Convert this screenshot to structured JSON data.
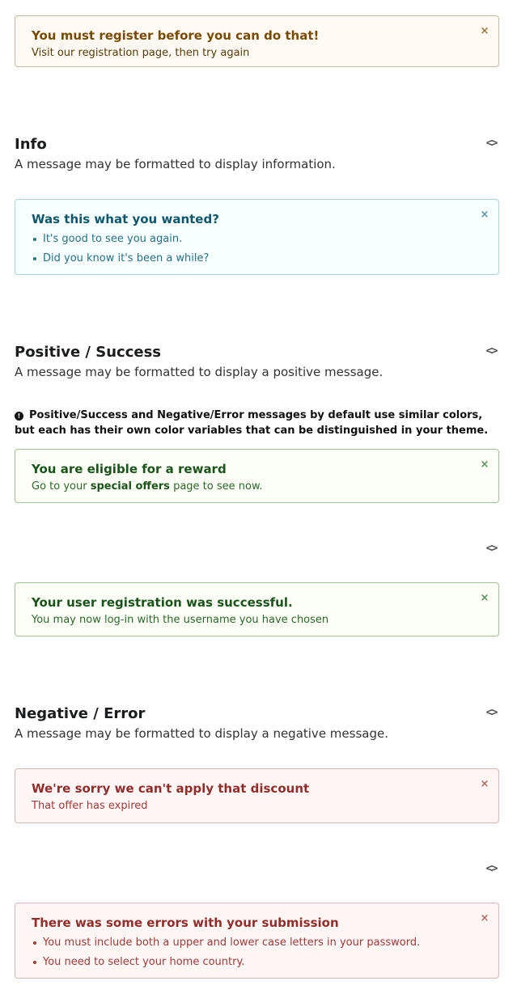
{
  "warning": {
    "header": "You must register before you can do that!",
    "body": "Visit our registration page, then try again",
    "close_icon": "×"
  },
  "sections": {
    "info": {
      "title": "Info",
      "description": "A message may be formatted to display information."
    },
    "positive": {
      "title": "Positive / Success",
      "description": "A message may be formatted to display a positive message."
    },
    "negative": {
      "title": "Negative / Error",
      "description": "A message may be formatted to display a negative message."
    }
  },
  "code_toggle": "<>",
  "info_message": {
    "header": "Was this what you wanted?",
    "items": [
      "It's good to see you again.",
      "Did you know it's been a while?"
    ],
    "close_icon": "×"
  },
  "note": {
    "icon": "!",
    "text": "Positive/Success and Negative/Error messages by default use similar colors, but each has their own color variables that can be distinguished in your theme."
  },
  "positive_message_1": {
    "header": "You are eligible for a reward",
    "body_prefix": "Go to your ",
    "body_strong": "special offers",
    "body_suffix": " page to see now.",
    "close_icon": "×"
  },
  "positive_message_2": {
    "header": "Your user registration was successful.",
    "body": "You may now log-in with the username you have chosen",
    "close_icon": "×"
  },
  "negative_message_1": {
    "header": "We're sorry we can't apply that discount",
    "body": "That offer has expired",
    "close_icon": "×"
  },
  "negative_message_2": {
    "header": "There was some errors with your submission",
    "items": [
      "You must include both a upper and lower case letters in your password.",
      "You need to select your home country."
    ],
    "close_icon": "×"
  },
  "colors": {
    "warning_bg": "#fffaf3",
    "warning_text": "#794b02",
    "info_bg": "#f8ffff",
    "info_text": "#0e566c",
    "positive_bg": "#fcfff5",
    "positive_text": "#2c662d",
    "negative_bg": "#fff6f6",
    "negative_text": "#9f3a38"
  }
}
